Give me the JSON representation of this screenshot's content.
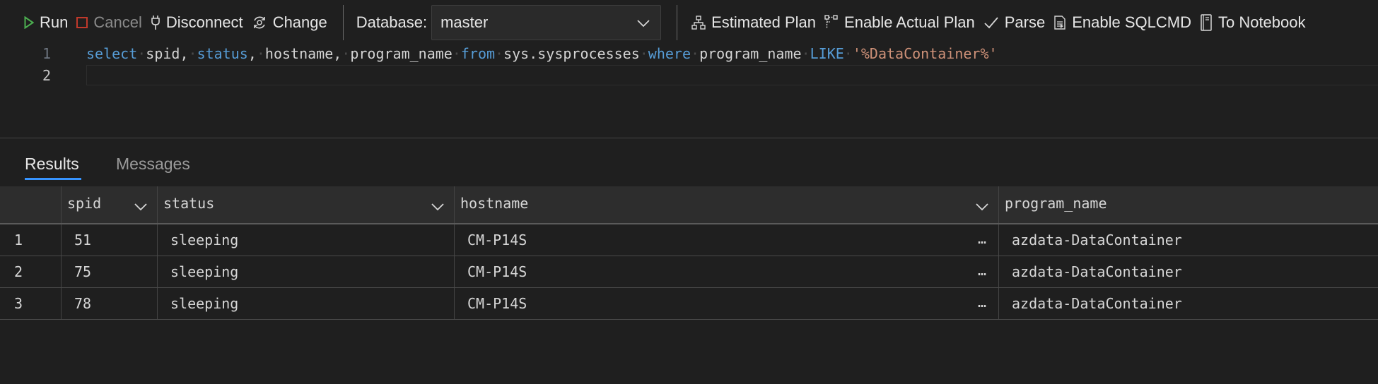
{
  "toolbar": {
    "run": "Run",
    "cancel": "Cancel",
    "disconnect": "Disconnect",
    "change": "Change",
    "database_label": "Database:",
    "database_value": "master",
    "estimated_plan": "Estimated Plan",
    "enable_actual_plan": "Enable Actual Plan",
    "parse": "Parse",
    "enable_sqlcmd": "Enable SQLCMD",
    "to_notebook": "To Notebook",
    "icons": [
      "play-icon",
      "stop-icon",
      "disconnect-plug-icon",
      "change-connection-icon",
      "chevron-down-icon",
      "hierarchy-icon",
      "actual-plan-icon",
      "checkmark-icon",
      "sqlcmd-icon",
      "notebook-icon"
    ],
    "colors": {
      "run_icon": "#4caf50",
      "cancel_icon": "#c0392b"
    }
  },
  "editor": {
    "lines": [
      {
        "number": "1",
        "tokens": {
          "select": "select",
          "spid": "spid,",
          "status": "status",
          "comma1": ",",
          "hostname": "hostname,",
          "program_name": "program_name",
          "from": "from",
          "table": "sys.sysprocesses",
          "where": "where",
          "col": "program_name",
          "like": "LIKE",
          "literal": "'%DataContainer%'"
        }
      },
      {
        "number": "2"
      }
    ],
    "colors": {
      "keyword": "#569cd6",
      "string": "#ce9178",
      "text": "#d4d4d4"
    }
  },
  "results": {
    "tabs": [
      {
        "label": "Results",
        "active": true
      },
      {
        "label": "Messages",
        "active": false
      }
    ],
    "columns": [
      "spid",
      "status",
      "hostname",
      "program_name"
    ],
    "rows": [
      {
        "index": "1",
        "spid": "51",
        "status": "sleeping",
        "hostname": "CM-P14S",
        "program_name": "azdata-DataContainer"
      },
      {
        "index": "2",
        "spid": "75",
        "status": "sleeping",
        "hostname": "CM-P14S",
        "program_name": "azdata-DataContainer"
      },
      {
        "index": "3",
        "spid": "78",
        "status": "sleeping",
        "hostname": "CM-P14S",
        "program_name": "azdata-DataContainer"
      }
    ],
    "truncation": "…",
    "accent": "#3794ff"
  }
}
